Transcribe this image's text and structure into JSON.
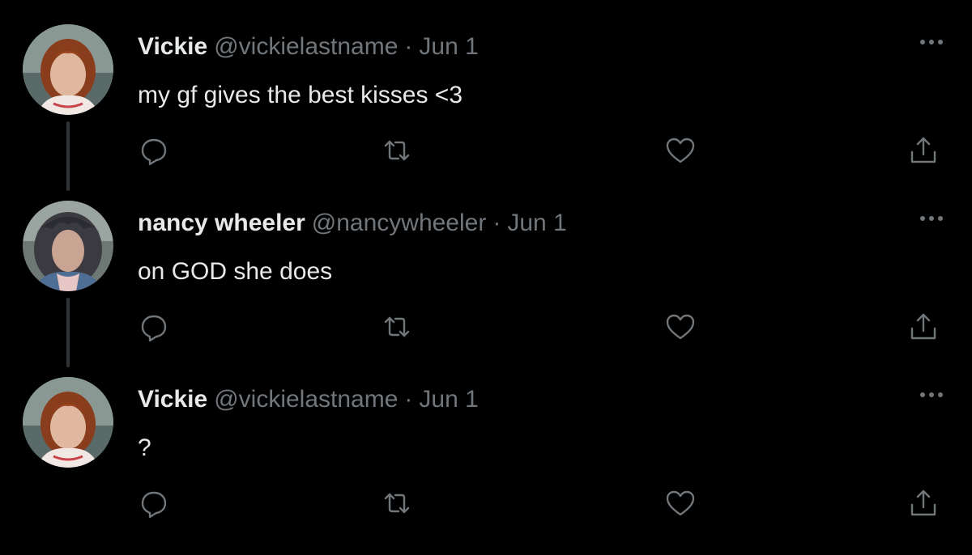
{
  "colors": {
    "background": "#000000",
    "primary_text": "#e7e9ea",
    "secondary_text": "#71767b",
    "thread_line": "#2f3336"
  },
  "tweets": [
    {
      "name": "Vickie",
      "handle": "@vickielastname",
      "separator": "·",
      "date": "Jun 1",
      "text": "my gf gives the best kisses <3",
      "avatar": "vickie-avatar",
      "icons": [
        "reply-icon",
        "retweet-icon",
        "like-icon",
        "share-icon",
        "more-icon"
      ]
    },
    {
      "name": "nancy wheeler",
      "handle": "@nancywheeler",
      "separator": "·",
      "date": "Jun 1",
      "text": "on GOD she does",
      "avatar": "nancy-avatar",
      "icons": [
        "reply-icon",
        "retweet-icon",
        "like-icon",
        "share-icon",
        "more-icon"
      ]
    },
    {
      "name": "Vickie",
      "handle": "@vickielastname",
      "separator": "·",
      "date": "Jun 1",
      "text": "?",
      "avatar": "vickie-avatar",
      "icons": [
        "reply-icon",
        "retweet-icon",
        "like-icon",
        "share-icon",
        "more-icon"
      ]
    }
  ]
}
